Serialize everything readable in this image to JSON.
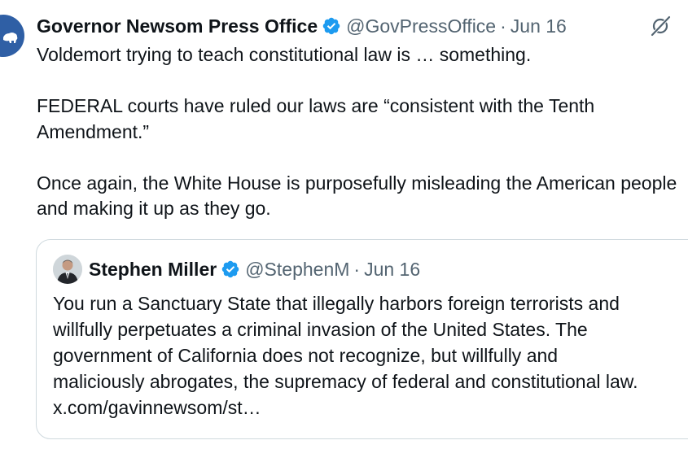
{
  "tweet": {
    "author": {
      "display_name": "Governor Newsom Press Office",
      "handle": "@GovPressOffice",
      "verified_icon": "verified-badge-icon"
    },
    "separator": "·",
    "date": "Jun 16",
    "grok_icon": "grok-icon",
    "paragraphs": [
      "Voldemort trying to teach constitutional law is … something.",
      "FEDERAL courts have ruled our laws are “consistent with the Tenth Amendment.”",
      "Once again, the White House is purposefully misleading the American people and making it up as they go."
    ]
  },
  "quoted_tweet": {
    "author": {
      "display_name": "Stephen Miller",
      "handle": "@StephenM",
      "verified_icon": "verified-badge-icon"
    },
    "separator": "·",
    "date": "Jun 16",
    "text": "You run a Sanctuary State that illegally harbors foreign terrorists and\nwillfully perpetuates a criminal invasion of the United States. The\ngovernment of California does not recognize, but willfully and\nmaliciously abrogates, the supremacy of federal and constitutional law.\nx.com/gavinnewsom/st…"
  },
  "colors": {
    "text": "#0f1419",
    "secondary": "#536471",
    "verified": "#1d9bf0",
    "border": "#cfd9de",
    "avatar_bg": "#2f5fa5"
  }
}
